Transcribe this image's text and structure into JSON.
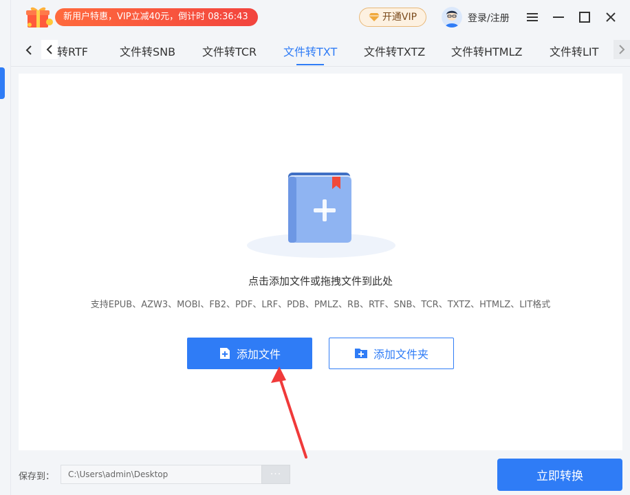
{
  "promo": {
    "text": "新用户特惠，VIP立减40元，倒计时 08:36:43"
  },
  "header": {
    "vip_label": "开通VIP",
    "login_label": "登录/注册"
  },
  "tabs": [
    {
      "label": "转RTF",
      "active": false
    },
    {
      "label": "文件转SNB",
      "active": false
    },
    {
      "label": "文件转TCR",
      "active": false
    },
    {
      "label": "文件转TXT",
      "active": true
    },
    {
      "label": "文件转TXTZ",
      "active": false
    },
    {
      "label": "文件转HTMLZ",
      "active": false
    },
    {
      "label": "文件转LIT",
      "active": false
    }
  ],
  "dropzone": {
    "title": "点击添加文件或拖拽文件到此处",
    "supported": "支持EPUB、AZW3、MOBI、FB2、PDF、LRF、PDB、PMLZ、RB、RTF、SNB、TCR、TXTZ、HTMLZ、LIT格式"
  },
  "buttons": {
    "add_file": "添加文件",
    "add_folder": "添加文件夹",
    "convert": "立即转换"
  },
  "save": {
    "label": "保存到：",
    "path": "C:\\Users\\admin\\Desktop",
    "browse": "···"
  },
  "colors": {
    "accent": "#2f7cf6",
    "promo": "#f2443e",
    "annotation": "#f03a3a"
  }
}
